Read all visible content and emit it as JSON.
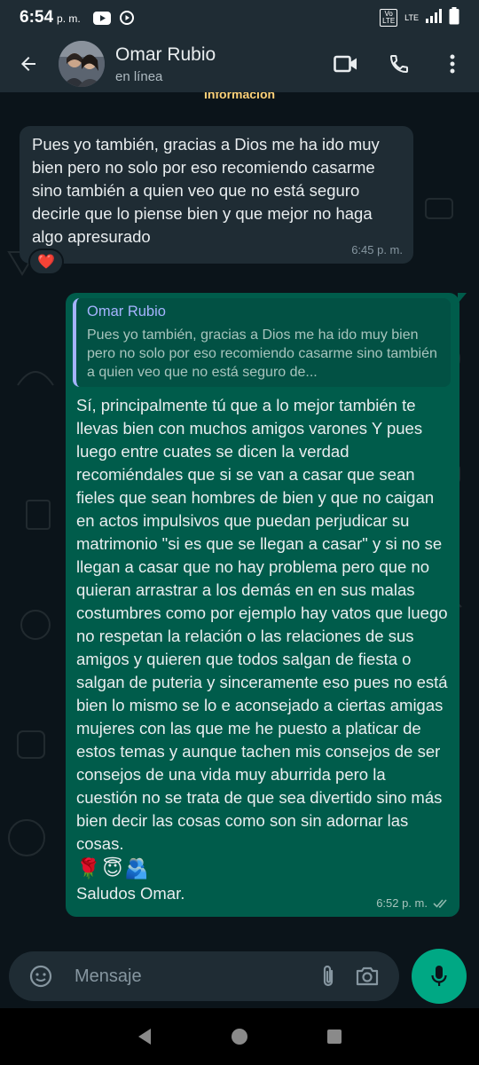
{
  "status_bar": {
    "time": "6:54",
    "period": "p. m.",
    "volte_line1": "Vo",
    "volte_line2": "LTE",
    "network": "LTE"
  },
  "header": {
    "contact_name": "Omar Rubio",
    "contact_status": "en línea"
  },
  "chat": {
    "date_chip": "Información",
    "incoming": {
      "text": "Pues yo también, gracias a Dios me ha ido muy bien pero no solo por eso recomiendo casarme sino también a quien veo que no está seguro decirle que lo piense bien y que mejor no haga algo apresurado",
      "time": "6:45 p. m.",
      "reaction": "❤️"
    },
    "outgoing": {
      "quote_author": "Omar Rubio",
      "quote_text": "Pues yo también, gracias a Dios me ha ido muy bien pero no solo por eso recomiendo casarme sino también a quien veo que no está seguro de...",
      "text": "Sí, principalmente tú que a lo mejor también te llevas bien con muchos amigos varones Y pues luego entre cuates se dicen la verdad recomiéndales que si se van a casar que sean fieles que sean hombres de bien y que no caigan en actos impulsivos que puedan perjudicar su matrimonio \"si es que se llegan a casar\" y si no se llegan a casar que no hay problema pero que no quieran arrastrar a los demás en en sus malas costumbres como por ejemplo hay vatos que luego no respetan la relación o las relaciones de sus amigos y quieren que todos salgan de fiesta o salgan de puteria y sinceramente eso pues no está bien lo mismo se lo e aconsejado a ciertas amigas mujeres con las que me he puesto a platicar de estos temas y aunque tachen mis consejos de ser consejos de una vida muy aburrida pero la cuestión no se trata de que sea divertido sino más bien decir las cosas como son sin adornar las cosas.",
      "emoji_1": "🌹",
      "emoji_2": "😇",
      "emoji_3": "🫂",
      "signoff": "Saludos Omar.",
      "time": "6:52 p. m."
    }
  },
  "input": {
    "placeholder": "Mensaje"
  },
  "colors": {
    "header_bg": "#1f2c34",
    "chat_bg": "#0b141a",
    "incoming_bubble": "#1f2c34",
    "outgoing_bubble": "#005c4b",
    "accent": "#00a884",
    "quote_author": "#a5b3ff"
  },
  "icons": {
    "back": "arrow-left-icon",
    "video": "video-camera-icon",
    "call": "phone-icon",
    "menu": "more-vertical-icon",
    "emoji": "emoji-icon",
    "attach": "paperclip-icon",
    "camera": "camera-icon",
    "mic": "microphone-icon",
    "read_receipt": "double-check-icon"
  }
}
